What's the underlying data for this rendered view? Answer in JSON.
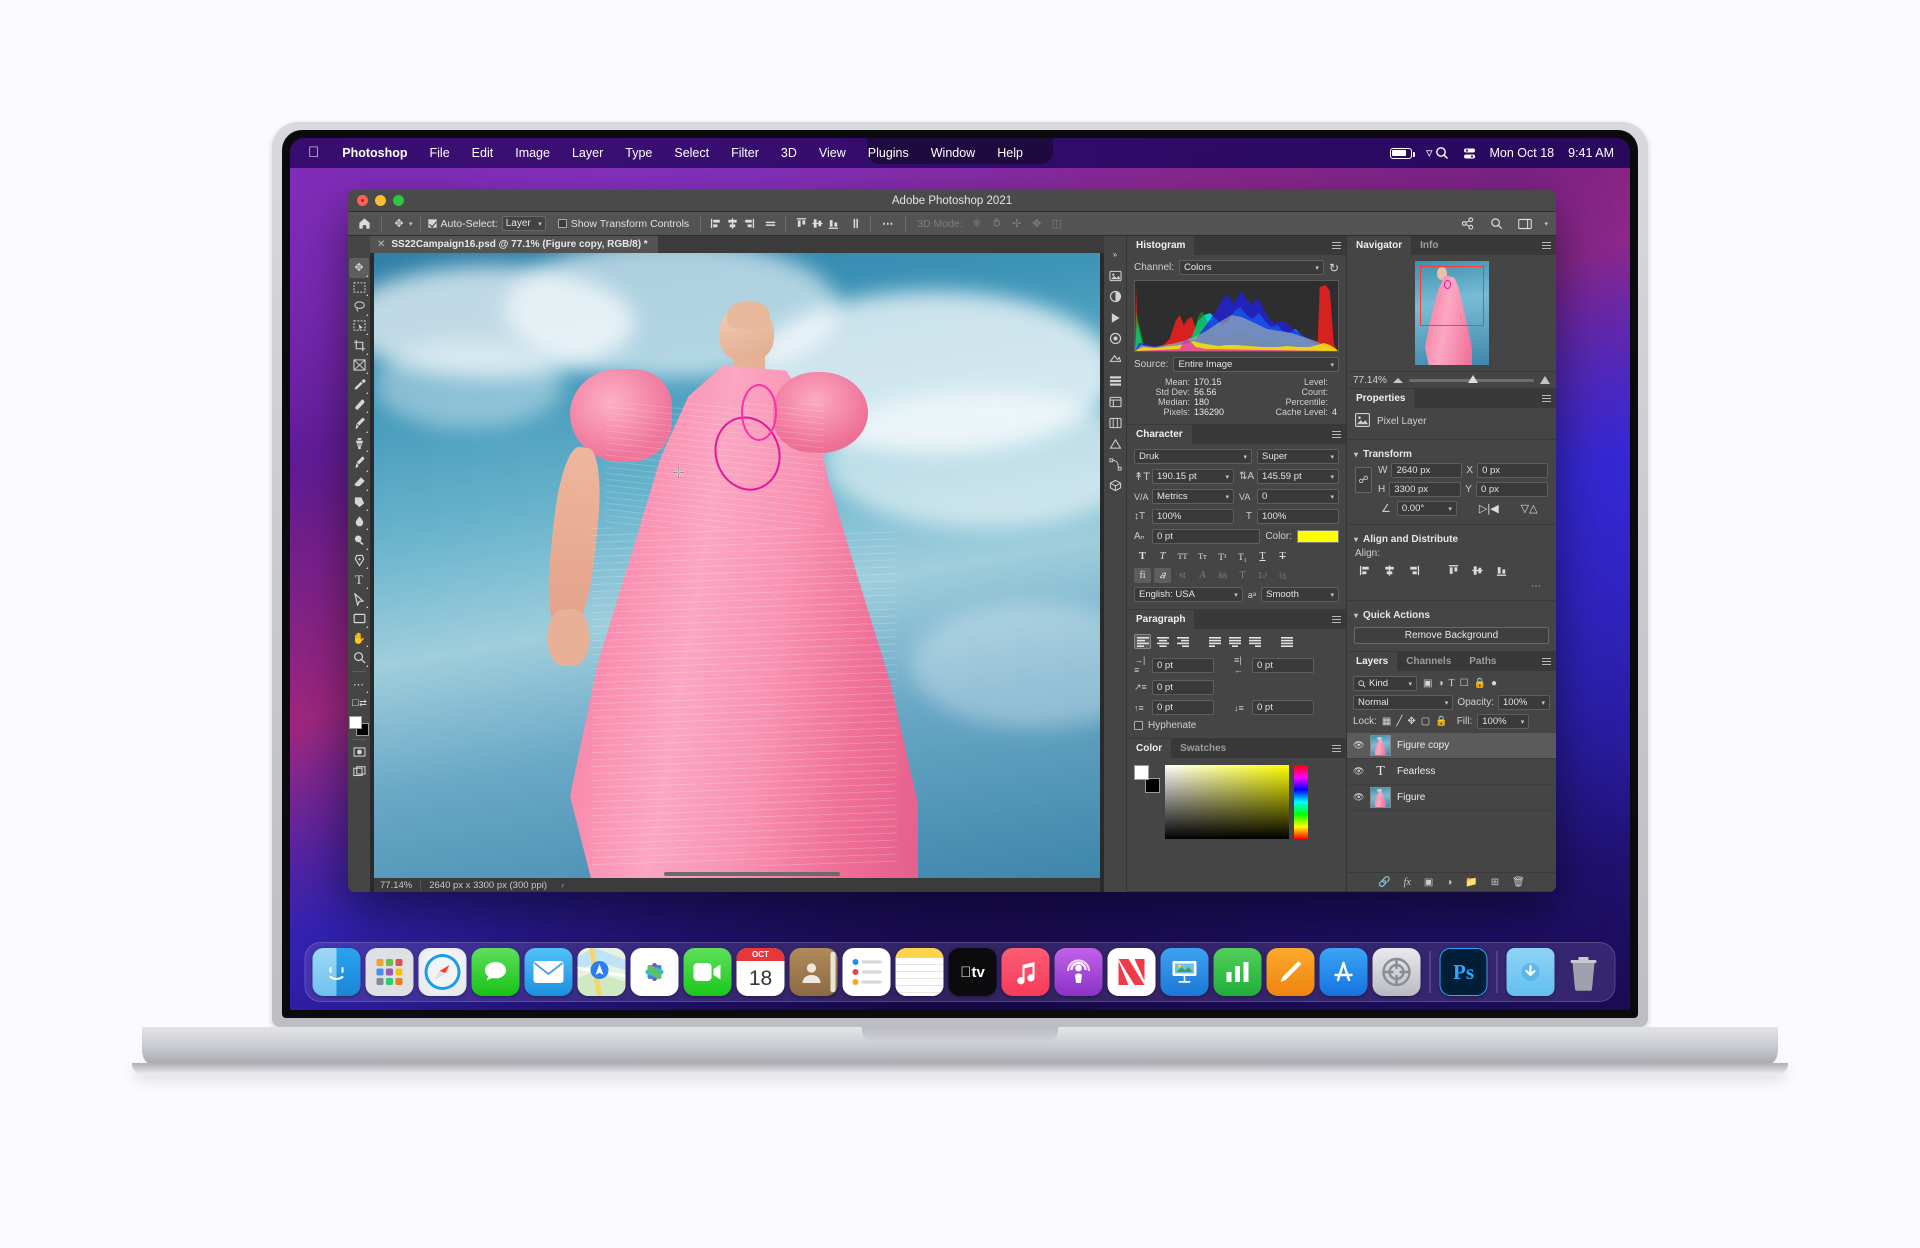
{
  "menubar": {
    "apple_icon": "apple-logo-icon",
    "items": [
      "Photoshop",
      "File",
      "Edit",
      "Image",
      "Layer",
      "Type",
      "Select",
      "Filter",
      "3D",
      "View",
      "Plugins",
      "Window",
      "Help"
    ],
    "status": {
      "battery_icon": "battery-icon",
      "wifi_icon": "wifi-icon",
      "search_icon": "search-icon",
      "control_center_icon": "control-center-icon",
      "date": "Mon Oct 18",
      "time": "9:41 AM"
    }
  },
  "window": {
    "title": "Adobe Photoshop 2021",
    "traffic_lights": [
      "close-button",
      "minimize-button",
      "zoom-button"
    ]
  },
  "options_bar": {
    "home_icon": "home-icon",
    "tool_icon": "move-tool-icon",
    "auto_select_checked": true,
    "auto_select_label": "Auto-Select:",
    "auto_select_value": "Layer",
    "show_transform_label": "Show Transform Controls",
    "show_transform_checked": false,
    "align_icons": [
      "align-left-edges-icon",
      "align-horizontal-centers-icon",
      "align-right-edges-icon",
      "distribute-horizontally-icon"
    ],
    "align_icons_2": [
      "align-top-edges-icon",
      "align-vertical-centers-icon",
      "align-bottom-edges-icon",
      "distribute-vertically-icon"
    ],
    "more_icon": "ellipsis-icon",
    "mode_3d_label": "3D Mode:",
    "mode_3d_icons": [
      "rotate-3d-icon",
      "roll-3d-icon",
      "drag-3d-icon",
      "slide-3d-icon",
      "scale-3d-icon"
    ],
    "right_icons": [
      "share-icon",
      "search-icon",
      "workspace-icon"
    ]
  },
  "document": {
    "tab_title": "SS22Campaign16.psd @ 77.1% (Figure copy, RGB/8) *",
    "close_icon": "close-tab-icon",
    "status_zoom": "77.14%",
    "status_size": "2640 px x 3300 px (300 ppi)",
    "status_arrow": "›"
  },
  "tools": [
    {
      "name": "move-tool",
      "glyph": "✥",
      "selected": true
    },
    {
      "name": "rectangular-marquee-tool",
      "glyph": "⬚",
      "selected": false
    },
    {
      "name": "lasso-tool",
      "glyph": "○",
      "selected": false
    },
    {
      "name": "object-selection-tool",
      "glyph": "⬚",
      "selected": false
    },
    {
      "name": "crop-tool",
      "glyph": "⌐",
      "selected": false
    },
    {
      "name": "frame-tool",
      "glyph": "⌧",
      "selected": false
    },
    {
      "name": "eyedropper-tool",
      "glyph": "✐",
      "selected": false
    },
    {
      "name": "spot-healing-brush-tool",
      "glyph": "❈",
      "selected": false
    },
    {
      "name": "brush-tool",
      "glyph": "✐",
      "selected": false
    },
    {
      "name": "clone-stamp-tool",
      "glyph": "⚑",
      "selected": false
    },
    {
      "name": "history-brush-tool",
      "glyph": "✒",
      "selected": false
    },
    {
      "name": "eraser-tool",
      "glyph": "◢",
      "selected": false
    },
    {
      "name": "gradient-tool",
      "glyph": "◧",
      "selected": false
    },
    {
      "name": "blur-tool",
      "glyph": "●",
      "selected": false
    },
    {
      "name": "dodge-tool",
      "glyph": "⚲",
      "selected": false
    },
    {
      "name": "pen-tool",
      "glyph": "✑",
      "selected": false
    },
    {
      "name": "type-tool",
      "glyph": "T",
      "selected": false
    },
    {
      "name": "path-selection-tool",
      "glyph": "➤",
      "selected": false
    },
    {
      "name": "rectangle-tool",
      "glyph": "▭",
      "selected": false
    },
    {
      "name": "hand-tool",
      "glyph": "✋",
      "selected": false
    },
    {
      "name": "zoom-tool",
      "glyph": "⌕",
      "selected": false
    },
    {
      "name": "edit-toolbar",
      "glyph": "…",
      "selected": false
    },
    {
      "name": "default-colors",
      "glyph": "❐",
      "selected": false
    },
    {
      "name": "quick-mask-mode",
      "glyph": "▣",
      "selected": false
    },
    {
      "name": "screen-mode",
      "glyph": "❐",
      "selected": false
    }
  ],
  "icon_rail": [
    "collapse-panels-icon",
    "libraries-icon",
    "adjustments-icon",
    "actions-icon",
    "styles-icon",
    "patterns-icon",
    "history-icon",
    "comments-icon",
    "gradients-icon",
    "shapes-icon",
    "paths-icon",
    "3d-icon"
  ],
  "histogram": {
    "tab": "Histogram",
    "channel_label": "Channel:",
    "channel_value": "Colors",
    "refresh_icon": "refresh-icon",
    "source_label": "Source:",
    "source_value": "Entire Image",
    "stats": [
      {
        "label": "Mean:",
        "value": "170.15"
      },
      {
        "label": "Std Dev:",
        "value": "56.56"
      },
      {
        "label": "Median:",
        "value": "180"
      },
      {
        "label": "Pixels:",
        "value": "136290"
      }
    ],
    "stats_right": [
      {
        "label": "Level:",
        "value": ""
      },
      {
        "label": "Count:",
        "value": ""
      },
      {
        "label": "Percentile:",
        "value": ""
      },
      {
        "label": "Cache Level:",
        "value": "4"
      }
    ]
  },
  "character": {
    "tab": "Character",
    "font_family": "Druk",
    "font_style": "Super",
    "font_size": "190.15 pt",
    "leading": "145.59 pt",
    "kerning": "Metrics",
    "tracking": "0",
    "vertical_scale": "100%",
    "horizontal_scale": "100%",
    "baseline_shift": "0 pt",
    "color_label": "Color:",
    "color_value": "#ffff00",
    "language": "English: USA",
    "antialias": "Smooth",
    "style_buttons": [
      "faux-bold-icon",
      "faux-italic-icon",
      "all-caps-icon",
      "small-caps-icon",
      "superscript-icon",
      "subscript-icon",
      "underline-icon",
      "strikethrough-icon"
    ],
    "opentype_buttons": [
      "standard-ligatures-icon",
      "contextual-alternates-icon",
      "discretionary-ligatures-icon",
      "swash-icon",
      "stylistic-alternates-icon",
      "titling-alternates-icon",
      "ordinals-icon",
      "fractions-icon"
    ]
  },
  "paragraph": {
    "tab": "Paragraph",
    "align_buttons": [
      "align-left-icon",
      "align-center-icon",
      "align-right-icon",
      "justify-last-left-icon",
      "justify-last-center-icon",
      "justify-last-right-icon",
      "justify-all-icon"
    ],
    "indent_left": "0 pt",
    "indent_right": "0 pt",
    "indent_first_line": "0 pt",
    "space_before": "0 pt",
    "space_after": "0 pt",
    "hyphenate_label": "Hyphenate",
    "hyphenate_checked": false
  },
  "color_panel": {
    "tabs": [
      "Color",
      "Swatches"
    ],
    "active_tab": "Color",
    "foreground": "#ffffff",
    "background": "#000000"
  },
  "navigator": {
    "tabs": [
      "Navigator",
      "Info"
    ],
    "active_tab": "Navigator",
    "zoom": "77.14%"
  },
  "properties": {
    "tab": "Properties",
    "layer_type_icon": "pixel-layer-icon",
    "layer_type": "Pixel Layer",
    "transform": {
      "title": "Transform",
      "link_icon": "link-aspect-ratio-icon",
      "w_label": "W",
      "w_value": "2640 px",
      "h_label": "H",
      "h_value": "3300 px",
      "x_label": "X",
      "x_value": "0 px",
      "y_label": "Y",
      "y_value": "0 px",
      "angle_icon": "rotate-angle-icon",
      "angle_value": "0.00°",
      "flip_horizontal_icon": "flip-horizontal-icon",
      "flip_vertical_icon": "flip-vertical-icon"
    },
    "align": {
      "title": "Align and Distribute",
      "label": "Align:",
      "buttons": [
        "align-left-edges-icon",
        "align-horizontal-centers-icon",
        "align-right-edges-icon",
        "align-top-edges-icon",
        "align-vertical-centers-icon",
        "align-bottom-edges-icon"
      ],
      "more_icon": "ellipsis-icon"
    },
    "quick_actions": {
      "title": "Quick Actions",
      "button": "Remove Background"
    }
  },
  "layers": {
    "tabs": [
      "Layers",
      "Channels",
      "Paths"
    ],
    "active_tab": "Layers",
    "filter_icon": "search-icon",
    "filter_value": "Kind",
    "filter_type_icons": [
      "pixel-filter-icon",
      "adjustment-filter-icon",
      "type-filter-icon",
      "shape-filter-icon",
      "smart-object-filter-icon",
      "filter-toggle-icon"
    ],
    "blend_mode": "Normal",
    "opacity_label": "Opacity:",
    "opacity_value": "100%",
    "lock_label": "Lock:",
    "lock_icons": [
      "lock-transparent-pixels-icon",
      "lock-image-pixels-icon",
      "lock-position-icon",
      "lock-artboard-nesting-icon",
      "lock-all-icon"
    ],
    "fill_label": "Fill:",
    "fill_value": "100%",
    "items": [
      {
        "name": "Figure copy",
        "type": "image",
        "visible": true,
        "selected": true
      },
      {
        "name": "Fearless",
        "type": "text",
        "visible": true,
        "selected": false
      },
      {
        "name": "Figure",
        "type": "image",
        "visible": true,
        "selected": false
      }
    ],
    "footer_icons": [
      "link-layers-icon",
      "layer-style-icon",
      "layer-mask-icon",
      "adjustment-layer-icon",
      "new-group-icon",
      "new-layer-icon",
      "delete-layer-icon"
    ]
  },
  "dock": {
    "items": [
      {
        "name": "finder",
        "label": "Finder",
        "running": true
      },
      {
        "name": "launchpad",
        "label": "Launchpad",
        "running": false
      },
      {
        "name": "safari",
        "label": "Safari",
        "running": false
      },
      {
        "name": "messages",
        "label": "Messages",
        "running": false
      },
      {
        "name": "mail",
        "label": "Mail",
        "running": false
      },
      {
        "name": "maps",
        "label": "Maps",
        "running": false
      },
      {
        "name": "photos",
        "label": "Photos",
        "running": false
      },
      {
        "name": "facetime",
        "label": "FaceTime",
        "running": false
      },
      {
        "name": "calendar",
        "label": "Calendar",
        "month": "OCT",
        "day": "18",
        "running": false
      },
      {
        "name": "contacts",
        "label": "Contacts",
        "running": false
      },
      {
        "name": "reminders",
        "label": "Reminders",
        "running": false
      },
      {
        "name": "notes",
        "label": "Notes",
        "running": false
      },
      {
        "name": "appletv",
        "label": "Apple TV",
        "running": false
      },
      {
        "name": "music",
        "label": "Music",
        "running": false
      },
      {
        "name": "podcasts",
        "label": "Podcasts",
        "running": false
      },
      {
        "name": "news",
        "label": "News",
        "running": false
      },
      {
        "name": "keynote",
        "label": "Keynote",
        "running": false
      },
      {
        "name": "numbers",
        "label": "Numbers",
        "running": false
      },
      {
        "name": "pages",
        "label": "Pages",
        "running": false
      },
      {
        "name": "appstore",
        "label": "App Store",
        "running": false
      },
      {
        "name": "system-preferences",
        "label": "System Preferences",
        "running": false
      },
      {
        "name": "photoshop",
        "label": "Photoshop",
        "running": true
      },
      {
        "name": "downloads-folder",
        "label": "Downloads",
        "running": false
      },
      {
        "name": "trash",
        "label": "Trash",
        "running": false
      }
    ]
  }
}
